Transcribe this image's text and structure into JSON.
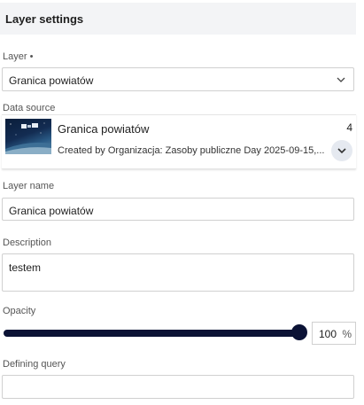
{
  "header": {
    "title": "Layer settings"
  },
  "layer": {
    "label": "Layer •",
    "selected": "Granica powiatów"
  },
  "data_source": {
    "label": "Data source",
    "title": "Granica powiatów",
    "subtitle": "Created by Organizacja: Zasoby publiczne Day 2025-09-15,...",
    "count": "4"
  },
  "layer_name": {
    "label": "Layer name",
    "value": "Granica powiatów"
  },
  "description": {
    "label": "Description",
    "value": "testem"
  },
  "opacity": {
    "label": "Opacity",
    "value": "100",
    "unit": "%",
    "level": 100
  },
  "defining_query": {
    "label": "Defining query",
    "value": ""
  },
  "colors": {
    "accent": "#0b1235",
    "header_bg": "#f3f4f6",
    "border": "#d0d0d0"
  }
}
